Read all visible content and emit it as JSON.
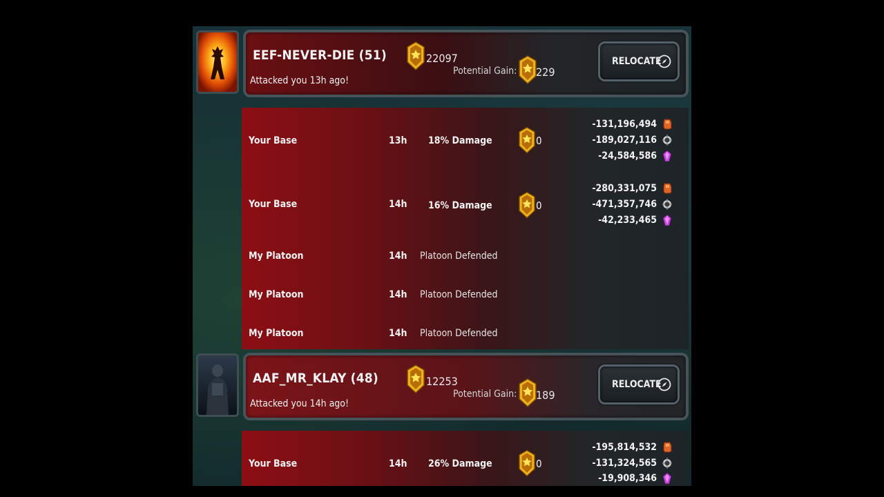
{
  "relocate_label": "RELOCATE",
  "potential_gain_label": "Potential Gain:",
  "players": [
    {
      "name": "EEF-NEVER-DIE (51)",
      "subtitle": "Attacked you 13h ago!",
      "score": "22097",
      "potential_gain": "229",
      "avatar": "flaming-figure-avatar",
      "entries": [
        {
          "target": "Your Base",
          "time": "13h",
          "result": "18% Damage",
          "medals": "0",
          "resources": [
            "-131,196,494",
            "-189,027,116",
            "-24,584,586"
          ]
        },
        {
          "target": "Your Base",
          "time": "14h",
          "result": "16% Damage",
          "medals": "0",
          "resources": [
            "-280,331,075",
            "-471,357,746",
            "-42,233,465"
          ]
        },
        {
          "target": "My Platoon",
          "time": "14h",
          "result": "Platoon Defended"
        },
        {
          "target": "My Platoon",
          "time": "14h",
          "result": "Platoon Defended"
        },
        {
          "target": "My Platoon",
          "time": "14h",
          "result": "Platoon Defended"
        }
      ]
    },
    {
      "name": "AAF_MR_KLAY (48)",
      "subtitle": "Attacked you 14h ago!",
      "score": "12253",
      "potential_gain": "189",
      "avatar": "dark-warrior-avatar",
      "entries": [
        {
          "target": "Your Base",
          "time": "14h",
          "result": "26% Damage",
          "medals": "0",
          "resources": [
            "-195,814,532",
            "-131,324,565",
            "-19,908,346"
          ]
        }
      ]
    }
  ],
  "resource_icons": [
    "metal-icon",
    "oil-icon",
    "crystal-icon"
  ],
  "colors": {
    "metal": "#e0652a",
    "oil": "#cfcfcf",
    "crystal": "#c24ad8",
    "medal_gold": "#f0b21e"
  }
}
